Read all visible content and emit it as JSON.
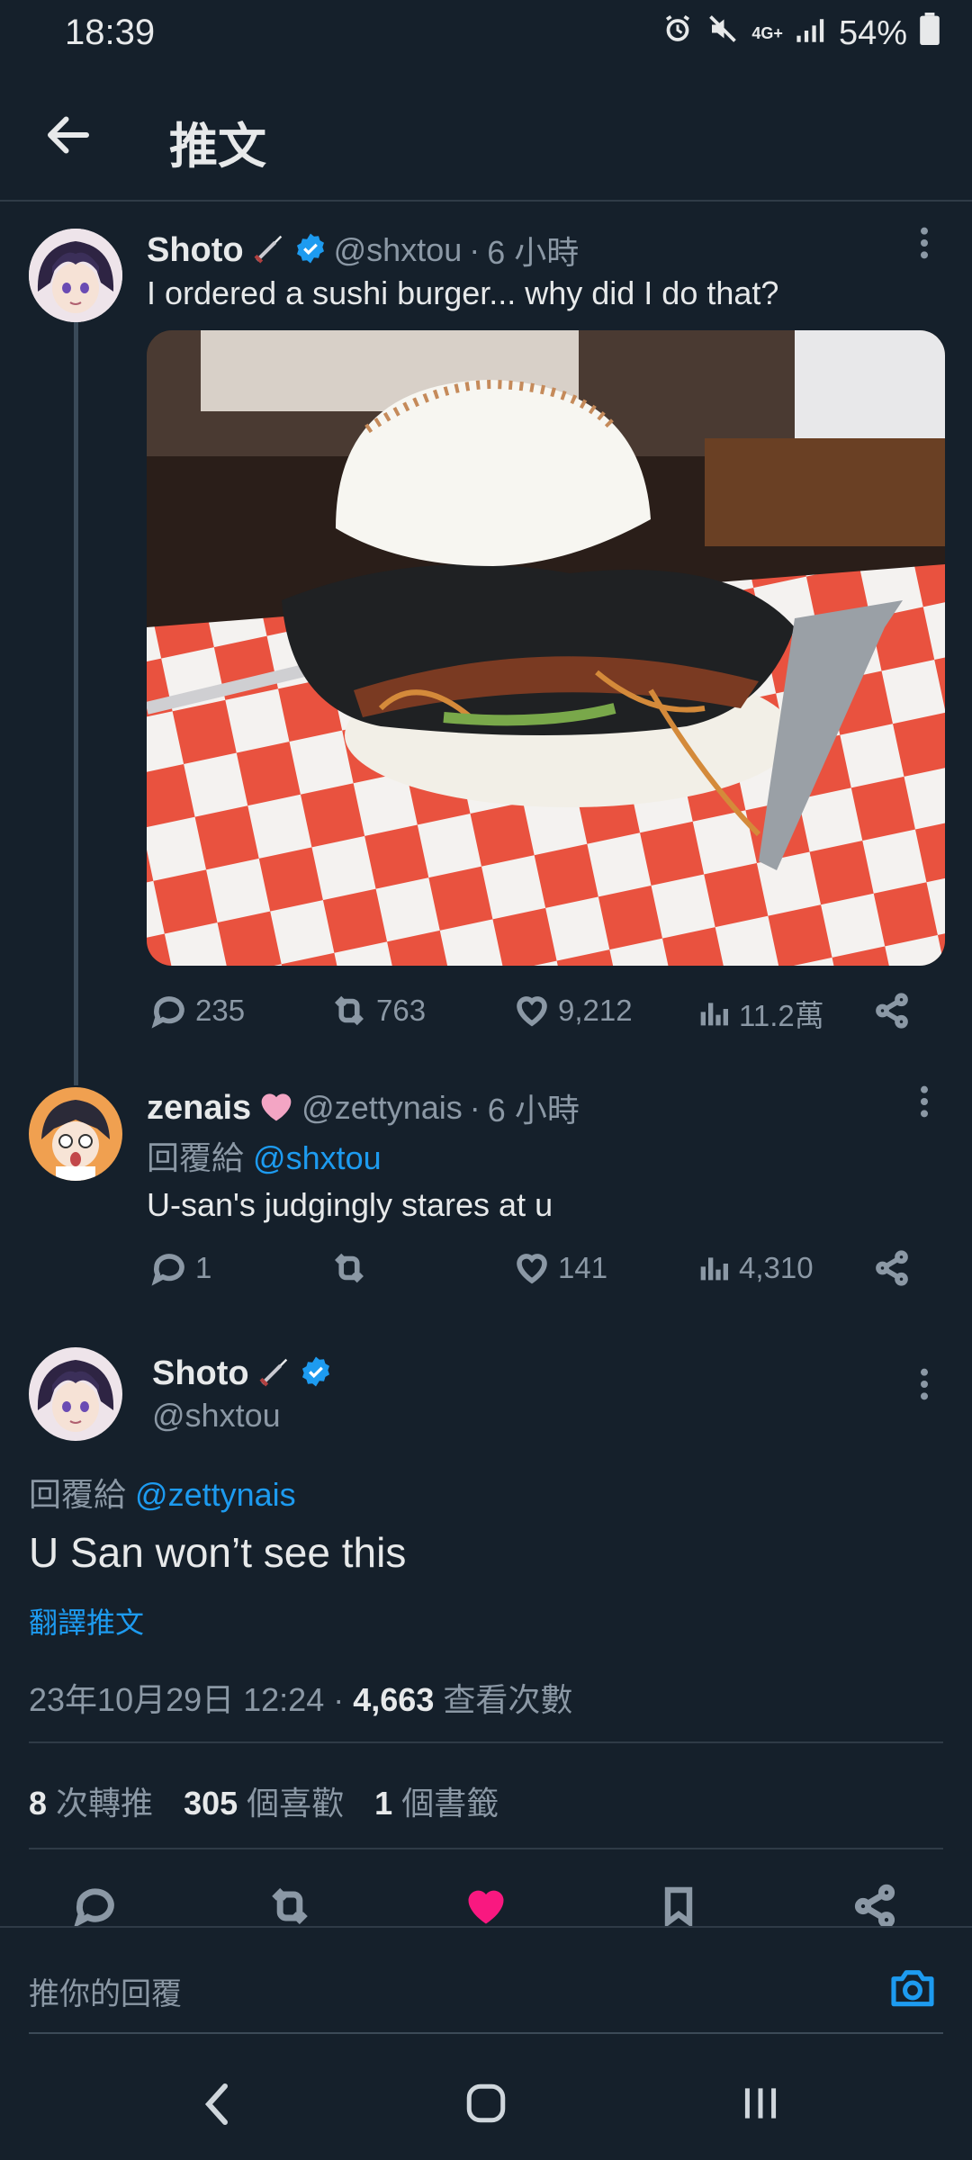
{
  "status_bar": {
    "time": "18:39",
    "network": "4G+",
    "battery": "54%"
  },
  "header": {
    "title": "推文"
  },
  "tweet1": {
    "name": "Shoto",
    "handle": "@shxtou",
    "time": "6 小時",
    "text": "I ordered a sushi burger... why did I do that?",
    "image_alt": "sushi burger photo",
    "replies": "235",
    "retweets": "763",
    "likes": "9,212",
    "views": "11.2萬"
  },
  "tweet2": {
    "name": "zenais",
    "handle": "@zettynais",
    "time": "6 小時",
    "reply_prefix": "回覆給",
    "reply_to": "@shxtou",
    "text": "U-san's judgingly stares at u",
    "replies": "1",
    "retweets": "",
    "likes": "141",
    "views": "4,310"
  },
  "main_tweet": {
    "name": "Shoto",
    "handle": "@shxtou",
    "reply_prefix": "回覆給",
    "reply_to": "@zettynais",
    "text": "U San won’t see this",
    "translate": "翻譯推文",
    "timestamp": "23年10月29日 12:24",
    "views_count": "4,663",
    "views_label": "查看次數",
    "retweet_count": "8",
    "retweet_label": "次轉推",
    "like_count": "305",
    "like_label": "個喜歡",
    "bookmark_count": "1",
    "bookmark_label": "個書籤"
  },
  "reply_box": {
    "placeholder": "推你的回覆"
  },
  "colors": {
    "background": "#15202b",
    "accent": "#1d9bf0",
    "like": "#f91880",
    "muted": "#8b98a5"
  },
  "icons": [
    "back-arrow-icon",
    "verified-icon",
    "sword-icon",
    "reply-icon",
    "retweet-icon",
    "heart-icon",
    "views-icon",
    "share-icon",
    "bookmark-icon",
    "camera-icon",
    "more-icon"
  ]
}
